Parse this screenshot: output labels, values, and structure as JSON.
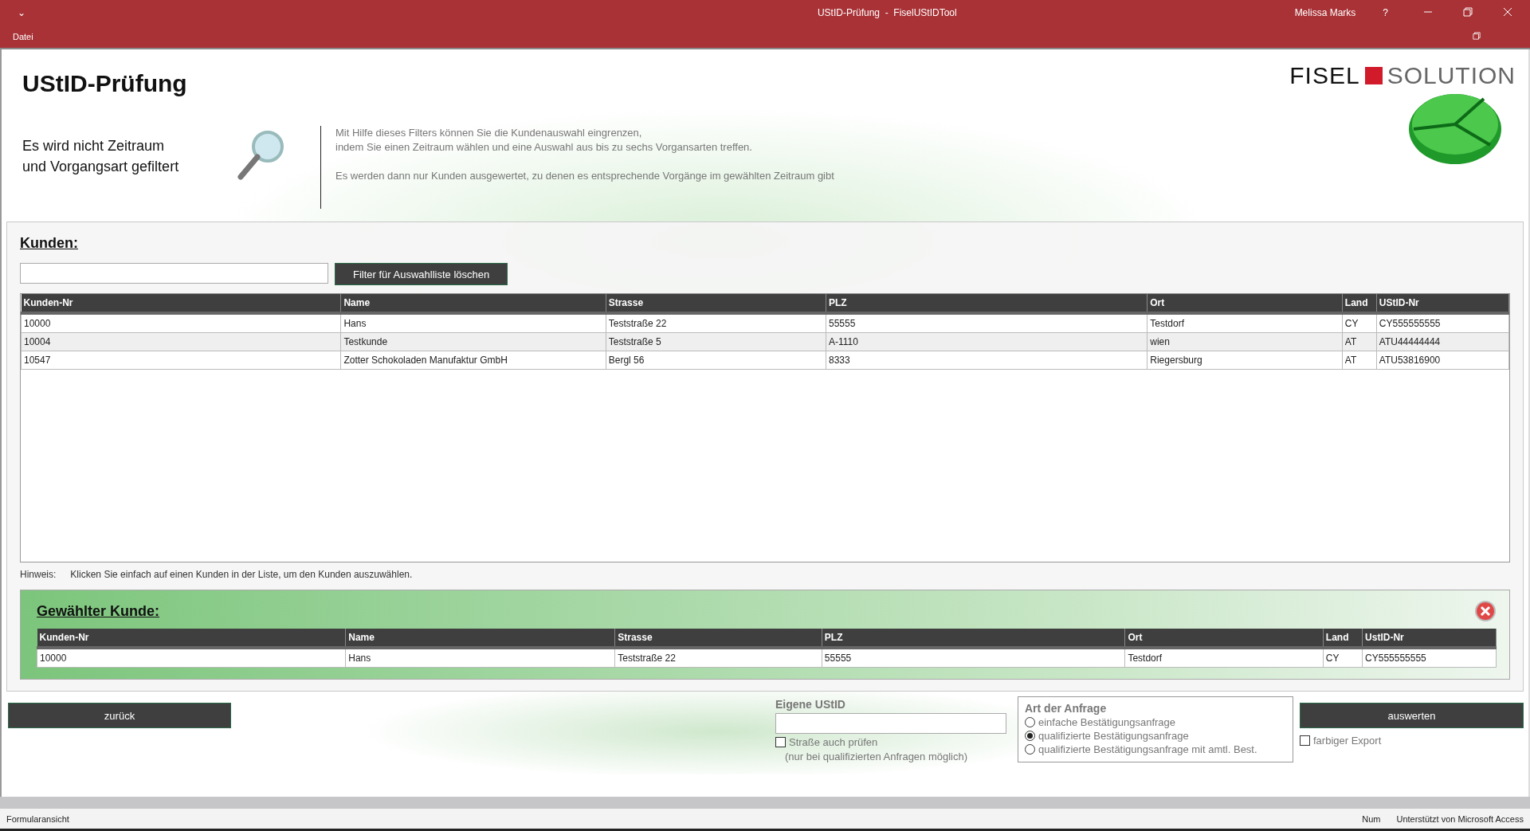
{
  "title_bar": {
    "menu_glyph": "⌄",
    "title": "UStID-Prüfung  -  FiselUStIDTool",
    "user": "Melissa Marks",
    "help": "?"
  },
  "menu_bar": {
    "items": [
      "Datei"
    ]
  },
  "header": {
    "title": "UStID-Prüfung",
    "filter_status": "Es wird nicht Zeitraum\nund Vorgangsart gefiltert",
    "info_paragraphs": [
      "Mit Hilfe dieses Filters können Sie die Kundenauswahl eingrenzen,\nindem Sie einen Zeitraum wählen und eine Auswahl aus bis zu sechs Vorgansarten treffen.",
      "Es werden dann nur Kunden ausgewertet, zu denen es entsprechende Vorgänge im gewählten Zeitraum gibt"
    ],
    "logo": {
      "left": "FISEL",
      "right": "SOLUTION"
    }
  },
  "customers": {
    "heading": "Kunden:",
    "clear_button": "Filter für Auswahlliste löschen",
    "columns": [
      "Kunden-Nr",
      "Name",
      "Strasse",
      "PLZ",
      "Ort",
      "Land",
      "UStID-Nr"
    ],
    "rows": [
      [
        "10000",
        "Hans",
        "Teststraße 22",
        "55555",
        "Testdorf",
        "CY",
        "CY555555555"
      ],
      [
        "10004",
        "Testkunde",
        "Teststraße 5",
        "A-1110",
        "wien",
        "AT",
        "ATU44444444"
      ],
      [
        "10547",
        "Zotter Schokoladen Manufaktur GmbH",
        "Bergl 56",
        "8333",
        "Riegersburg",
        "AT",
        "ATU53816900"
      ]
    ],
    "hint_label": "Hinweis:",
    "hint": "Klicken Sie einfach auf einen Kunden in der Liste, um den Kunden auszuwählen."
  },
  "selected_customer": {
    "heading": "Gewählter Kunde:",
    "columns": [
      "Kunden-Nr",
      "Name",
      "Strasse",
      "PLZ",
      "Ort",
      "Land",
      "UstID-Nr"
    ],
    "rows": [
      [
        "10000",
        "Hans",
        "Teststraße 22",
        "55555",
        "Testdorf",
        "CY",
        "CY555555555"
      ]
    ]
  },
  "footer": {
    "back_button": "zurück",
    "own_vat": {
      "label": "Eigene UStID"
    },
    "check_street": {
      "label": "Straße auch prüfen",
      "note": "(nur bei qualifizierten Anfragen möglich)",
      "checked": false
    },
    "request_type": {
      "label": "Art der Anfrage",
      "options": [
        {
          "label": "einfache Bestätigungsanfrage",
          "selected": false
        },
        {
          "label": "qualifizierte Bestätigungsanfrage",
          "selected": true
        },
        {
          "label": "qualifizierte Bestätigungsanfrage mit amtl. Best.",
          "selected": false
        }
      ]
    },
    "evaluate_button": "auswerten",
    "color_export": {
      "label": "farbiger Export",
      "checked": false
    }
  },
  "status_bar": {
    "left": "Formularansicht",
    "num": "Num",
    "powered": "Unterstützt von Microsoft Access"
  }
}
